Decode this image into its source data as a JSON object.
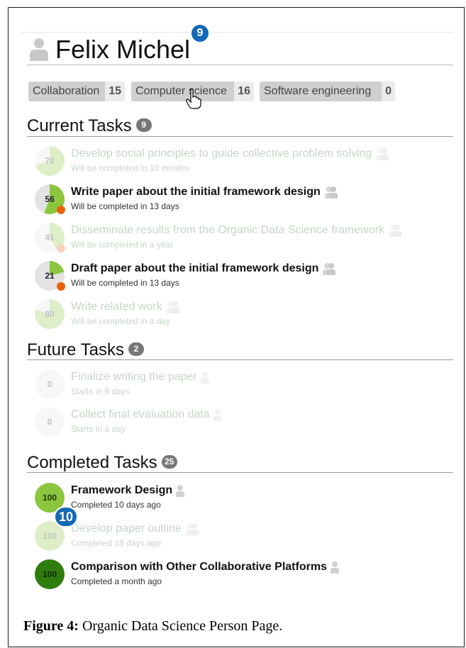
{
  "person": {
    "name": "Felix Michel"
  },
  "step_badges": {
    "name_badge": "9",
    "task_badge": "10"
  },
  "tags": [
    {
      "label": "Collaboration",
      "count": "15"
    },
    {
      "label": "Computer science",
      "count": "16"
    },
    {
      "label": "Software engineering",
      "count": "0"
    }
  ],
  "sections": {
    "current": {
      "title": "Current Tasks",
      "count": "9"
    },
    "future": {
      "title": "Future Tasks",
      "count": "2"
    },
    "completed": {
      "title": "Completed Tasks",
      "count": "25"
    }
  },
  "current_tasks": [
    {
      "progress": "70",
      "title": "Develop social principles to guide collective problem solving",
      "subtitle": "Will be completed in 10 months",
      "faded": true,
      "alert": false
    },
    {
      "progress": "56",
      "title": "Write paper about the initial framework design",
      "subtitle": "Will be completed in 13 days",
      "faded": false,
      "alert": true
    },
    {
      "progress": "41",
      "title": "Disseminate results from the Organic Data Science framework",
      "subtitle": "Will be completed in a year",
      "faded": true,
      "alert": true
    },
    {
      "progress": "21",
      "title": "Draft paper about the initial framework design",
      "subtitle": "Will be completed in 13 days",
      "faded": false,
      "alert": true
    },
    {
      "progress": "80",
      "title": "Write related work",
      "subtitle": "Will be completed in a day",
      "faded": true,
      "alert": false
    }
  ],
  "future_tasks": [
    {
      "progress": "0",
      "title": "Finalize writing the paper",
      "subtitle": "Starts in 9 days",
      "faded": true
    },
    {
      "progress": "0",
      "title": "Collect final evaluation data",
      "subtitle": "Starts in a day",
      "faded": true
    }
  ],
  "completed_tasks": [
    {
      "progress": "100",
      "title": "Framework Design",
      "subtitle": "Completed 10 days ago",
      "faded": false
    },
    {
      "progress": "100",
      "title": "Develop paper outline",
      "subtitle": "Completed 18 days ago",
      "faded": true
    },
    {
      "progress": "100",
      "title": "Comparison with Other Collaborative Platforms",
      "subtitle": "Completed a month ago",
      "faded": false
    }
  ],
  "caption": {
    "label": "Figure 4:",
    "text": " Organic Data Science Person Page."
  },
  "colors": {
    "progress_green": "#8cc63f",
    "dark_green": "#2f7d0e",
    "alert_orange": "#e8620c",
    "badge_blue": "#1468b5"
  }
}
